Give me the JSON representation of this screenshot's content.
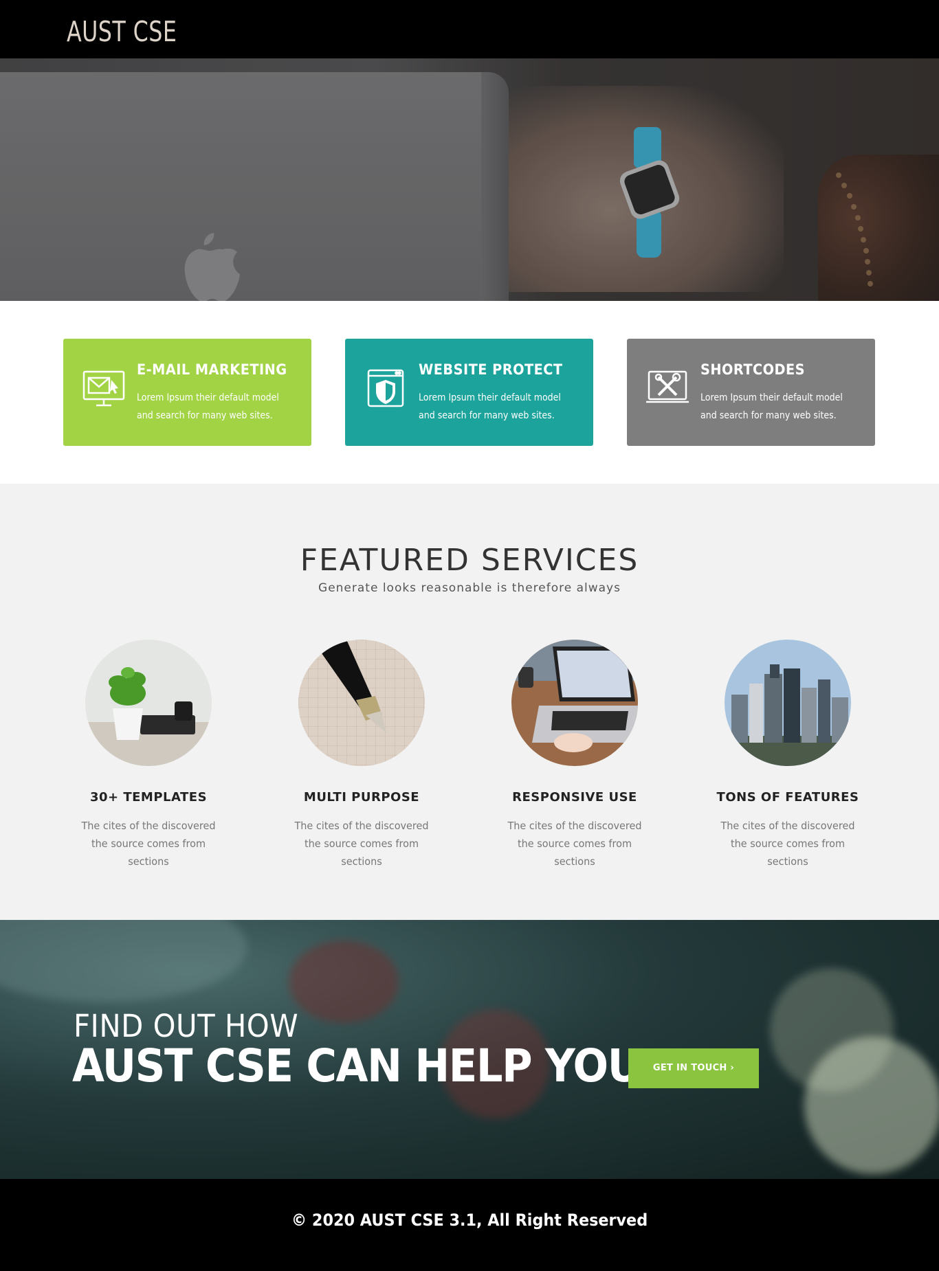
{
  "navbar": {
    "brand": "AUST CSE"
  },
  "feature_boxes": [
    {
      "title": "E-MAIL MARKETING",
      "desc": "Lorem Ipsum their default model and search for many web sites.",
      "icon": "email-marketing-icon",
      "color": "#a1d345"
    },
    {
      "title": "WEBSITE PROTECT",
      "desc": "Lorem Ipsum their default model and search for many web sites.",
      "icon": "shield-icon",
      "color": "#1ca39c"
    },
    {
      "title": "SHORTCODES",
      "desc": "Lorem Ipsum their default model and search for many web sites.",
      "icon": "tools-icon",
      "color": "#7e7e7e"
    }
  ],
  "services": {
    "heading": "FEATURED SERVICES",
    "subheading": "Generate looks reasonable is therefore always",
    "items": [
      {
        "title": "30+ TEMPLATES",
        "desc": "The cites of the discovered the source comes from sections",
        "image": "plant-desk-image"
      },
      {
        "title": "MULTI PURPOSE",
        "desc": "The cites of the discovered the source comes from sections",
        "image": "fountain-pen-image"
      },
      {
        "title": "RESPONSIVE USE",
        "desc": "The cites of the discovered the source comes from sections",
        "image": "laptop-image"
      },
      {
        "title": "TONS OF FEATURES",
        "desc": "The cites of the discovered the source comes from sections",
        "image": "city-skyline-image"
      }
    ]
  },
  "cta": {
    "line1": "FIND OUT HOW",
    "line2": "AUST CSE CAN HELP YOU",
    "button": "GET IN TOUCH ›",
    "button_color": "#8bc53f"
  },
  "footer": {
    "copyright": "©  2020 AUST CSE 3.1, All Right Reserved"
  }
}
